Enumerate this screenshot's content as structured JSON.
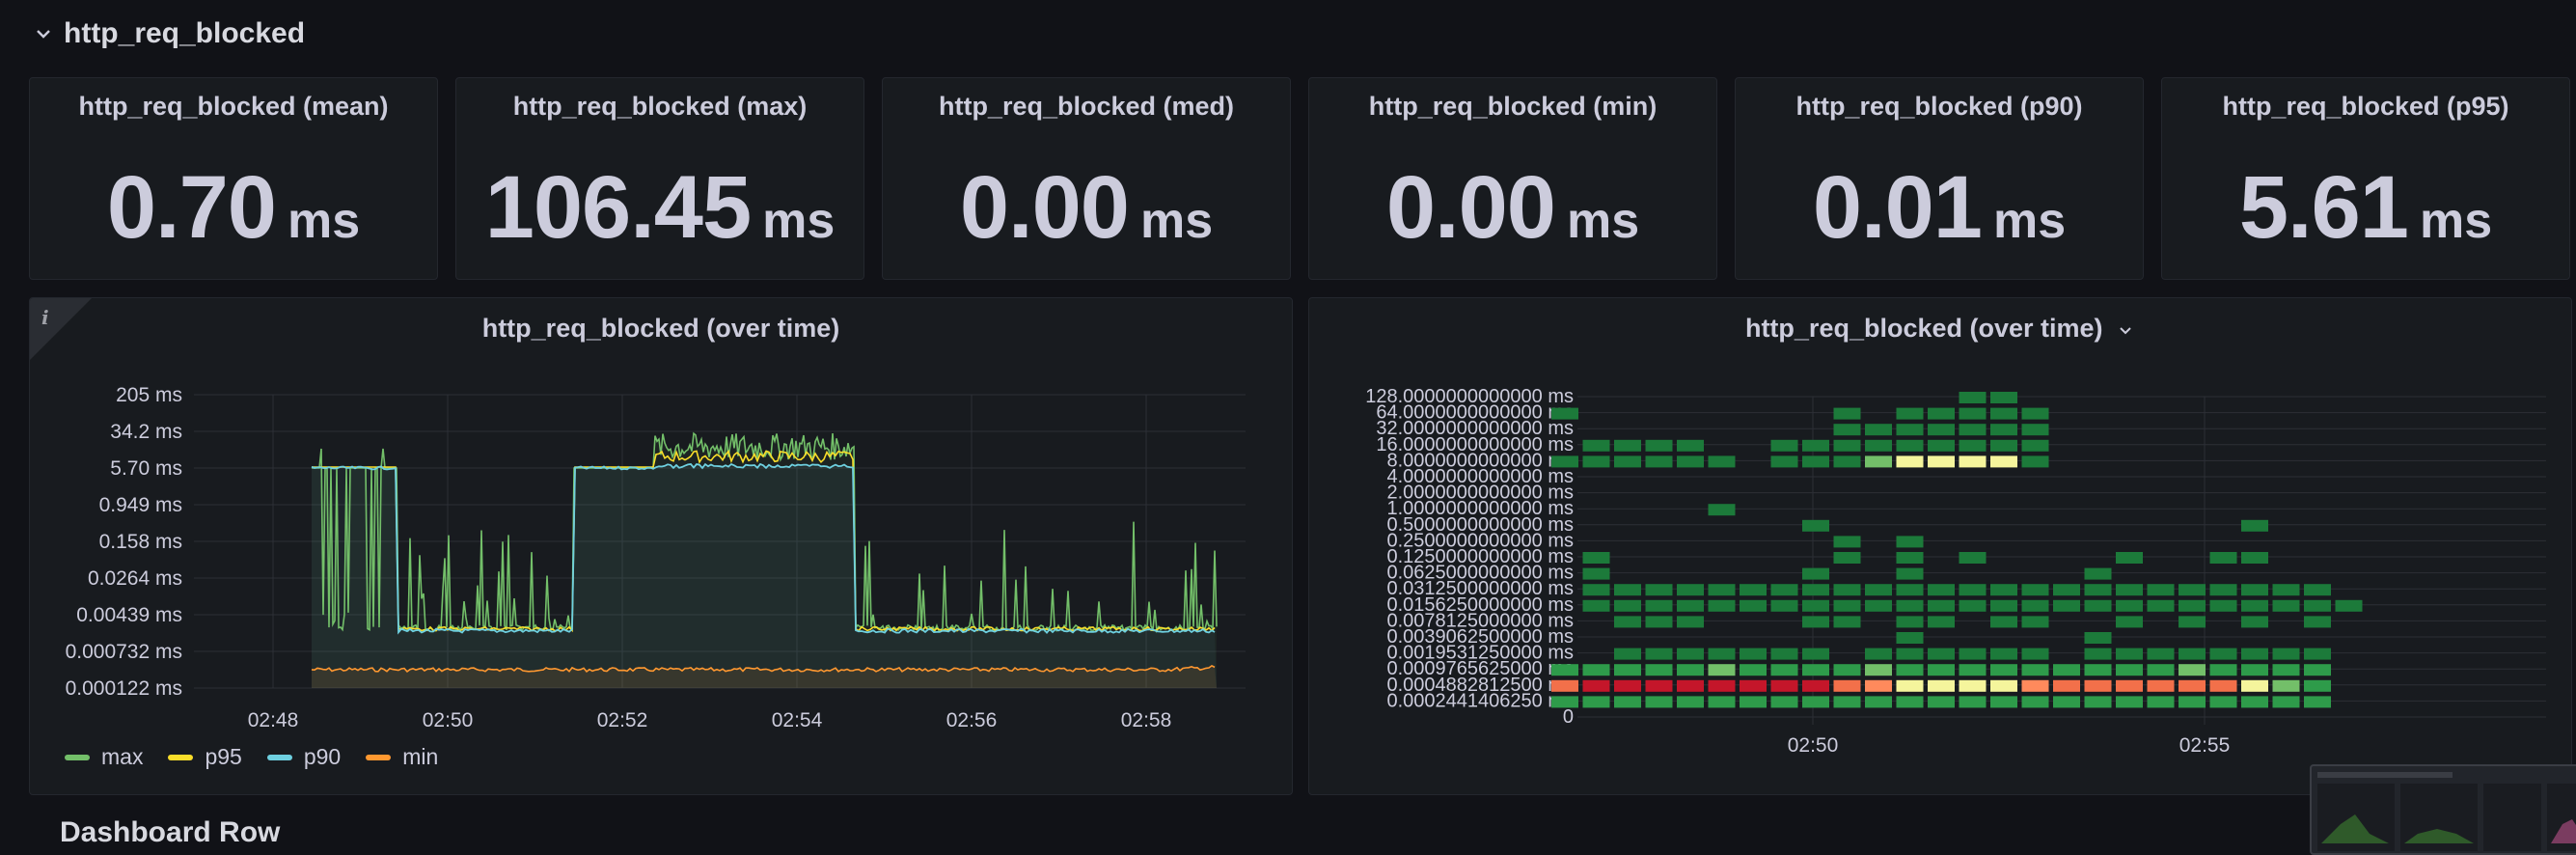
{
  "row": {
    "title": "http_req_blocked"
  },
  "stats": [
    {
      "title": "http_req_blocked (mean)",
      "value": "0.70",
      "unit": "ms"
    },
    {
      "title": "http_req_blocked (max)",
      "value": "106.45",
      "unit": "ms"
    },
    {
      "title": "http_req_blocked (med)",
      "value": "0.00",
      "unit": "ms"
    },
    {
      "title": "http_req_blocked (min)",
      "value": "0.00",
      "unit": "ms"
    },
    {
      "title": "http_req_blocked (p90)",
      "value": "0.01",
      "unit": "ms"
    },
    {
      "title": "http_req_blocked (p95)",
      "value": "5.61",
      "unit": "ms"
    }
  ],
  "timeseries": {
    "title": "http_req_blocked (over time)",
    "info_icon": "info-icon",
    "legend": [
      {
        "name": "max",
        "color": "#73bf69"
      },
      {
        "name": "p95",
        "color": "#fade2a"
      },
      {
        "name": "p90",
        "color": "#6ed0e0"
      },
      {
        "name": "min",
        "color": "#ff9830"
      }
    ]
  },
  "heatmap": {
    "title": "http_req_blocked (over time)",
    "menu_icon": "chevron-down-icon"
  },
  "chart_data": [
    {
      "type": "line",
      "title": "http_req_blocked (over time)",
      "scale": "log",
      "y_ticks": [
        "205 ms",
        "34.2 ms",
        "5.70 ms",
        "0.949 ms",
        "0.158 ms",
        "0.0264 ms",
        "0.00439 ms",
        "0.000732 ms",
        "0.000122 ms"
      ],
      "x_ticks": [
        "02:48",
        "02:50",
        "02:52",
        "02:54",
        "02:56",
        "02:58"
      ],
      "x": [
        "02:48:40",
        "02:49:40",
        "02:50:40",
        "02:51:10",
        "02:51:40",
        "02:52:40",
        "02:53:40",
        "02:54:40",
        "02:55:40",
        "02:56:40",
        "02:57:40",
        "02:58:40"
      ],
      "series": [
        {
          "name": "max",
          "values": [
            5.7,
            5.7,
            5.7,
            0.004,
            5.7,
            10,
            15,
            20,
            0.004,
            0.004,
            0.004,
            0.003
          ]
        },
        {
          "name": "p95",
          "values": [
            5.7,
            5.7,
            5.7,
            0.002,
            0.002,
            8,
            10,
            12,
            0.002,
            0.002,
            0.002,
            0.002
          ]
        },
        {
          "name": "p90",
          "values": [
            5.7,
            5.7,
            5.7,
            0.0015,
            0.0015,
            5.7,
            5.7,
            5.7,
            0.0015,
            0.0015,
            0.0015,
            0.0015
          ]
        },
        {
          "name": "min",
          "values": [
            0.0003,
            0.0003,
            0.0003,
            0.0003,
            0.0003,
            0.0003,
            0.0003,
            0.0003,
            0.0003,
            0.0003,
            0.0003,
            0.0004
          ]
        }
      ]
    },
    {
      "type": "heatmap",
      "title": "http_req_blocked (over time)",
      "y_buckets": [
        "128.0000000000000 ms",
        "64.0000000000000 ms",
        "32.0000000000000 ms",
        "16.0000000000000 ms",
        "8.0000000000000 ms",
        "4.0000000000000 ms",
        "2.0000000000000 ms",
        "1.0000000000000 ms",
        "0.5000000000000 ms",
        "0.2500000000000 ms",
        "0.1250000000000 ms",
        "0.0625000000000 ms",
        "0.0312500000000 ms",
        "0.0156250000000 ms",
        "0.0078125000000 ms",
        "0.0039062500000 ms",
        "0.0019531250000 ms",
        "0.0009765625000 ms",
        "0.0004882812500 ms",
        "0.0002441406250 ms",
        "0"
      ],
      "x_ticks": [
        "02:50",
        "02:55"
      ],
      "columns": 26,
      "legend": false
    }
  ]
}
